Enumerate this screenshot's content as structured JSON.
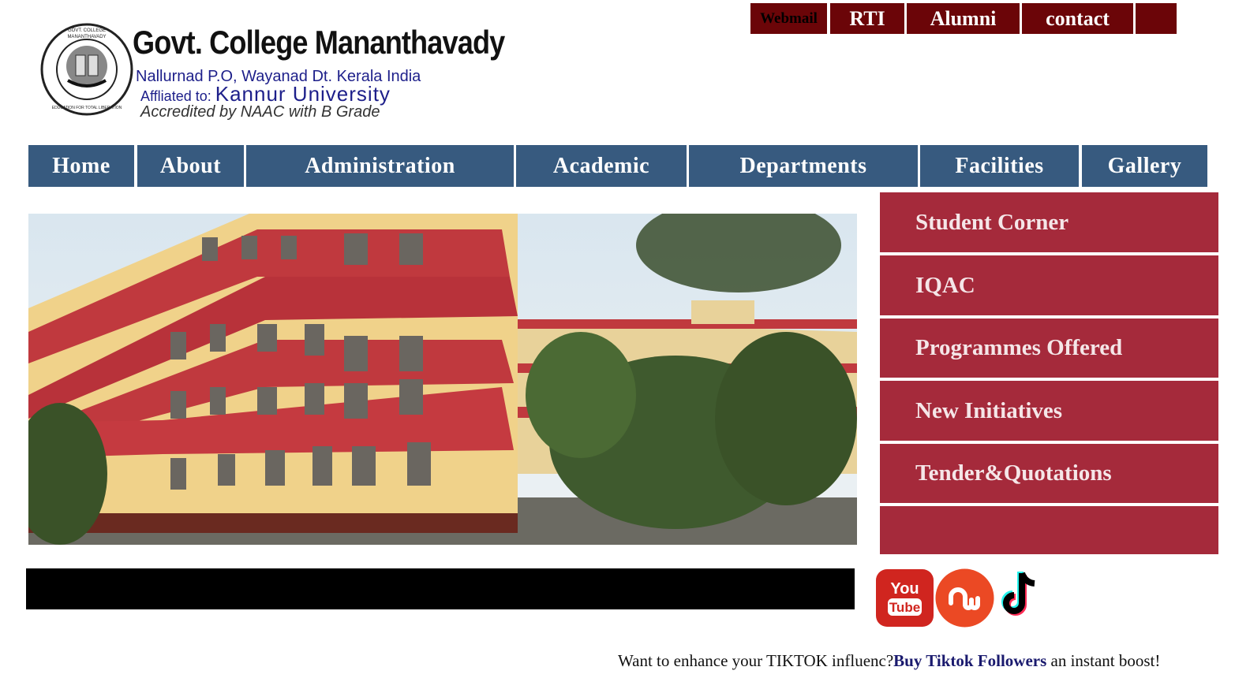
{
  "header": {
    "college_name": "Govt. College Mananthavady",
    "address": "Nallurnad P.O, Wayanad Dt. Kerala India",
    "affiliation_prefix": "Affliated to: ",
    "affiliation_university": "Kannur University",
    "accreditation": "Accredited by NAAC with B Grade",
    "logo_ring_top": "GOVT. COLLEGE",
    "logo_ring_top2": "MANANTHAVADY",
    "logo_ring_bottom": "EDUCATION FOR TOTAL LIBERATION"
  },
  "top_links": [
    {
      "label": "Webmail"
    },
    {
      "label": "RTI"
    },
    {
      "label": "Alumni"
    },
    {
      "label": "contact"
    },
    {
      "label": ""
    }
  ],
  "nav": {
    "items": [
      {
        "label": "Home"
      },
      {
        "label": "About"
      },
      {
        "label": "Administration"
      },
      {
        "label": "Academic"
      },
      {
        "label": "Departments"
      },
      {
        "label": "Facilities"
      },
      {
        "label": "Gallery"
      }
    ]
  },
  "side_menu": {
    "items": [
      {
        "label": "Student Corner"
      },
      {
        "label": "IQAC"
      },
      {
        "label": "Programmes Offered"
      },
      {
        "label": "New Initiatives"
      },
      {
        "label": "Tender&Quotations"
      },
      {
        "label": ""
      }
    ]
  },
  "social": {
    "youtube_text_top": "You",
    "youtube_text_bottom": "Tube",
    "icons": [
      "youtube-icon",
      "stumbleupon-icon",
      "tiktok-icon"
    ]
  },
  "promo": {
    "prefix": "Want to enhance your TIKTOK influenc?",
    "link": "Buy Tiktok Followers",
    "suffix": " an instant boost!"
  },
  "colors": {
    "nav_bg": "#375a7f",
    "side_menu_bg": "#a52a3b",
    "top_link_bg": "#6b0508"
  }
}
